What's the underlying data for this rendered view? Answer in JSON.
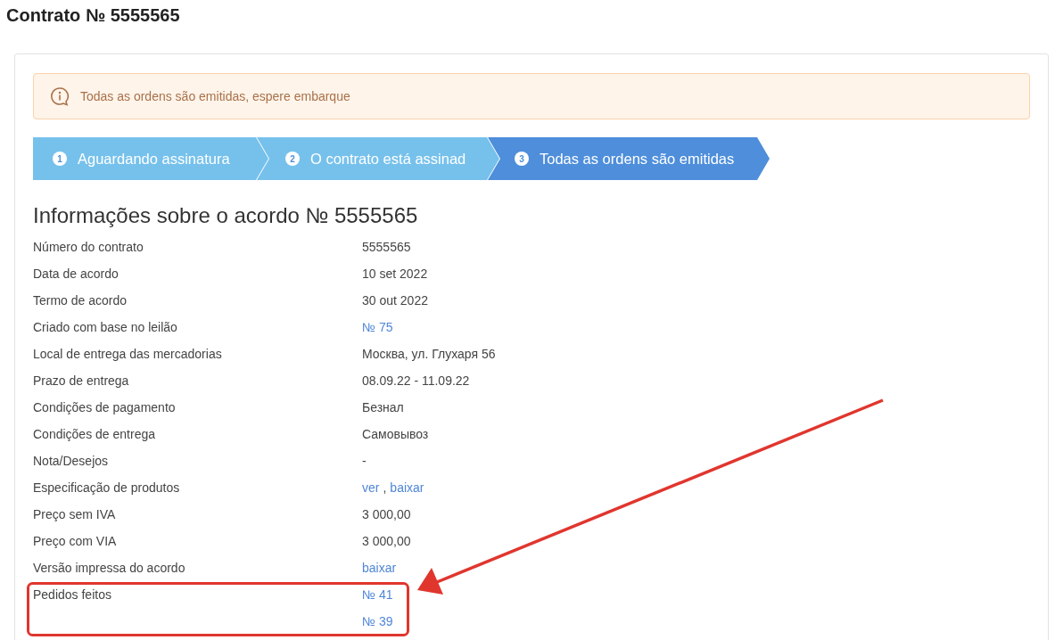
{
  "page_title": "Contrato № 5555565",
  "alert": {
    "text": "Todas as ordens são emitidas, espere embarque"
  },
  "steps": [
    {
      "number": "1",
      "label": "Aguardando assinatura",
      "selected": false
    },
    {
      "number": "2",
      "label": "O contrato está assinad",
      "selected": false
    },
    {
      "number": "3",
      "label": "Todas as ordens são emitidas",
      "selected": true
    }
  ],
  "section_title": "Informações sobre o acordo № 5555565",
  "rows": [
    {
      "label": "Número do contrato",
      "lines": [
        [
          {
            "kind": "text",
            "text": "5555565"
          }
        ]
      ]
    },
    {
      "label": "Data de acordo",
      "lines": [
        [
          {
            "kind": "text",
            "text": "10 set 2022"
          }
        ]
      ]
    },
    {
      "label": "Termo de acordo",
      "lines": [
        [
          {
            "kind": "text",
            "text": "30 out 2022"
          }
        ]
      ]
    },
    {
      "label": "Criado com base no leilão",
      "lines": [
        [
          {
            "kind": "link",
            "text": "№ 75"
          }
        ]
      ]
    },
    {
      "label": "Local de entrega das mercadorias",
      "lines": [
        [
          {
            "kind": "text",
            "text": "Москва, ул. Глухаря 56"
          }
        ]
      ]
    },
    {
      "label": "Prazo de entrega",
      "lines": [
        [
          {
            "kind": "text",
            "text": "08.09.22 - 11.09.22"
          }
        ]
      ]
    },
    {
      "label": "Condições de pagamento",
      "lines": [
        [
          {
            "kind": "text",
            "text": "Безнал"
          }
        ]
      ]
    },
    {
      "label": "Condições de entrega",
      "lines": [
        [
          {
            "kind": "text",
            "text": "Самовывоз"
          }
        ]
      ]
    },
    {
      "label": "Nota/Desejos",
      "lines": [
        [
          {
            "kind": "text",
            "text": "-"
          }
        ]
      ]
    },
    {
      "label": "Especificação de produtos",
      "lines": [
        [
          {
            "kind": "link",
            "text": "ver"
          },
          {
            "kind": "text",
            "text": ","
          },
          {
            "kind": "link",
            "text": "baixar"
          }
        ]
      ]
    },
    {
      "label": "Preço sem IVA",
      "lines": [
        [
          {
            "kind": "text",
            "text": "3 000,00"
          }
        ]
      ]
    },
    {
      "label": "Preço com VIA",
      "lines": [
        [
          {
            "kind": "text",
            "text": "3 000,00"
          }
        ]
      ]
    },
    {
      "label": "Versão impressa do acordo",
      "lines": [
        [
          {
            "kind": "link",
            "text": "baixar"
          }
        ]
      ]
    },
    {
      "label": "Pedidos feitos",
      "lines": [
        [
          {
            "kind": "link",
            "text": "№ 41"
          }
        ],
        [
          {
            "kind": "link",
            "text": "№ 39"
          }
        ]
      ]
    }
  ]
}
